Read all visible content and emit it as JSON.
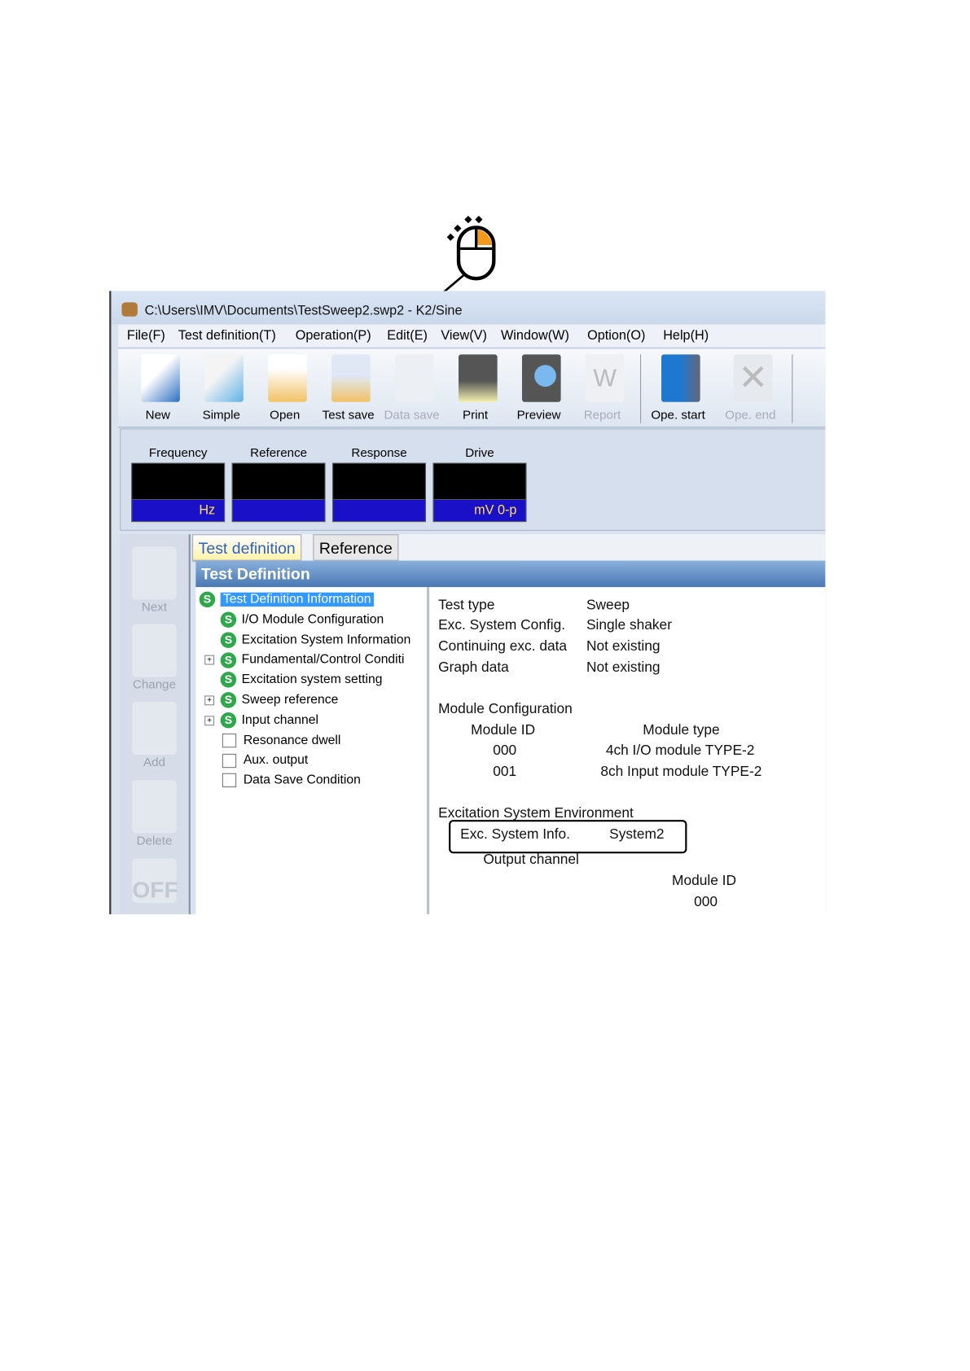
{
  "window": {
    "title": "C:\\Users\\IMV\\Documents\\TestSweep2.swp2 - K2/Sine"
  },
  "menu": [
    "File(F)",
    "Test definition(T)",
    "Operation(P)",
    "Edit(E)",
    "View(V)",
    "Window(W)",
    "Option(O)",
    "Help(H)"
  ],
  "toolbar": [
    {
      "label": "New",
      "icon": "new-document-icon",
      "enabled": true
    },
    {
      "label": "Simple",
      "icon": "simple-document-icon",
      "enabled": true
    },
    {
      "label": "Open",
      "icon": "open-folder-icon",
      "enabled": true
    },
    {
      "label": "Test save",
      "icon": "test-save-icon",
      "enabled": true
    },
    {
      "label": "Data save",
      "icon": "data-save-icon",
      "enabled": false
    },
    {
      "label": "Print",
      "icon": "printer-icon",
      "enabled": true
    },
    {
      "label": "Preview",
      "icon": "preview-icon",
      "enabled": true
    },
    {
      "label": "Report",
      "icon": "word-report-icon",
      "enabled": false
    },
    {
      "label": "Ope. start",
      "icon": "operation-start-icon",
      "enabled": true
    },
    {
      "label": "Ope. end",
      "icon": "operation-end-icon",
      "enabled": false
    }
  ],
  "meters": [
    {
      "label": "Frequency",
      "unit": "Hz"
    },
    {
      "label": "Reference",
      "unit": ""
    },
    {
      "label": "Response",
      "unit": ""
    },
    {
      "label": "Drive",
      "unit": "mV 0-p"
    }
  ],
  "side": [
    "Next",
    "Change",
    "Add",
    "Delete"
  ],
  "tabs": [
    "Test definition",
    "Reference"
  ],
  "header": "Test Definition",
  "tree": [
    {
      "label": "Test Definition Information",
      "type": "s",
      "selected": true
    },
    {
      "label": "I/O Module Configuration",
      "type": "s"
    },
    {
      "label": "Excitation System Information",
      "type": "s"
    },
    {
      "label": "Fundamental/Control Conditi",
      "type": "s",
      "expand": true
    },
    {
      "label": "Excitation system setting",
      "type": "s"
    },
    {
      "label": "Sweep reference",
      "type": "s",
      "expand": true
    },
    {
      "label": "Input channel",
      "type": "s",
      "expand": true
    },
    {
      "label": "Resonance dwell",
      "type": "box"
    },
    {
      "label": "Aux. output",
      "type": "box"
    },
    {
      "label": "Data Save Condition",
      "type": "box"
    }
  ],
  "detail": {
    "rows": [
      [
        "Test type",
        "Sweep"
      ],
      [
        "Exc. System Config.",
        "Single shaker"
      ],
      [
        "Continuing exc. data",
        "Not existing"
      ],
      [
        "Graph data",
        "Not existing"
      ]
    ],
    "module_title": "Module Configuration",
    "module_headers": [
      "Module ID",
      "Module type"
    ],
    "modules": [
      [
        "000",
        "4ch I/O module TYPE-2"
      ],
      [
        "001",
        "8ch Input module TYPE-2"
      ]
    ],
    "env_title": "Excitation System Environment",
    "env_label": "Exc. System Info.",
    "env_value": "System2",
    "output_channel": "Output channel",
    "out_header": "Module ID",
    "out_id": "000"
  },
  "colors": {
    "meter_unit_bg": "#1a10c8",
    "meter_unit_text": "#ffe24a",
    "header": "#4a78b4",
    "selected": "#3399ff",
    "status_ok": "#2ea84a",
    "cursor_highlight": "#f39a1e"
  }
}
